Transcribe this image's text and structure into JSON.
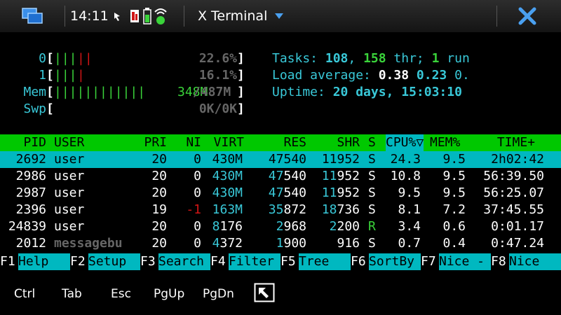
{
  "statusbar": {
    "time": "14:11",
    "app_title": "X Terminal",
    "icons": [
      "task-switcher-icon",
      "presence-icon",
      "network-icon",
      "battery-icon",
      "wifi-icon",
      "menu-arrow-icon",
      "close-icon"
    ]
  },
  "htop": {
    "cpu_meters": [
      {
        "label": "0",
        "bars": "|||||",
        "value": "22.6%"
      },
      {
        "label": "1",
        "bars": "||||",
        "value": "16.1%"
      }
    ],
    "mem": {
      "label": "Mem",
      "bars": "||||||||||||",
      "used": "348M",
      "total": "/487M"
    },
    "swp": {
      "label": "Swp",
      "value": "0K/0K"
    },
    "tasks": {
      "label": "Tasks: ",
      "count": "108",
      "sep": ", ",
      "thr": "158",
      "thr_label": " thr; ",
      "running": "1",
      "run_label": " run"
    },
    "load": {
      "label": "Load average: ",
      "v1": "0.38",
      "v2": "0.23",
      "v3": "0."
    },
    "uptime": {
      "label": "Uptime: ",
      "value": "20 days, 15:03:10"
    },
    "columns": [
      "PID",
      "USER",
      "PRI",
      "NI",
      "VIRT",
      "RES",
      "SHR",
      "S",
      "CPU%▽",
      "MEM%",
      "TIME+"
    ],
    "processes": [
      {
        "pid": "2692",
        "user": "user",
        "pri": "20",
        "ni": "0",
        "virt": "430M",
        "res": "47540",
        "shr": "11952",
        "s": "S",
        "cpu": "24.3",
        "mem": "9.5",
        "time": "2h02:42",
        "selected": true
      },
      {
        "pid": "2986",
        "user": "user",
        "pri": "20",
        "ni": "0",
        "virt": "430M",
        "res": "47540",
        "shr": "11952",
        "s": "S",
        "cpu": "10.8",
        "mem": "9.5",
        "time": "56:39.50"
      },
      {
        "pid": "2987",
        "user": "user",
        "pri": "20",
        "ni": "0",
        "virt": "430M",
        "res": "47540",
        "shr": "11952",
        "s": "S",
        "cpu": "9.5",
        "mem": "9.5",
        "time": "56:25.07"
      },
      {
        "pid": "2396",
        "user": "user",
        "pri": "19",
        "ni": "-1",
        "virt": "163M",
        "res": "35872",
        "shr": "18736",
        "s": "S",
        "cpu": "8.1",
        "mem": "7.2",
        "time": "37:45.55"
      },
      {
        "pid": "24839",
        "user": "user",
        "pri": "20",
        "ni": "0",
        "virt": "8176",
        "res": "2968",
        "shr": "2200",
        "s": "R",
        "cpu": "3.4",
        "mem": "0.6",
        "time": "0:01.17"
      },
      {
        "pid": "2012",
        "user": "messagebu",
        "pri": "20",
        "ni": "0",
        "virt": "4372",
        "res": "1900",
        "shr": "916",
        "s": "S",
        "cpu": "0.7",
        "mem": "0.4",
        "time": "0:47.24"
      }
    ],
    "function_keys": [
      {
        "key": "F1",
        "label": "Help  "
      },
      {
        "key": "F2",
        "label": "Setup "
      },
      {
        "key": "F3",
        "label": "Search"
      },
      {
        "key": "F4",
        "label": "Filter"
      },
      {
        "key": "F5",
        "label": "Tree  "
      },
      {
        "key": "F6",
        "label": "SortBy"
      },
      {
        "key": "F7",
        "label": "Nice -"
      },
      {
        "key": "F8",
        "label": "Nice "
      }
    ]
  },
  "keybar": {
    "keys": [
      "Ctrl",
      "Tab",
      "Esc",
      "PgUp",
      "PgDn"
    ],
    "fullscreen_icon": "fullscreen-icon"
  }
}
